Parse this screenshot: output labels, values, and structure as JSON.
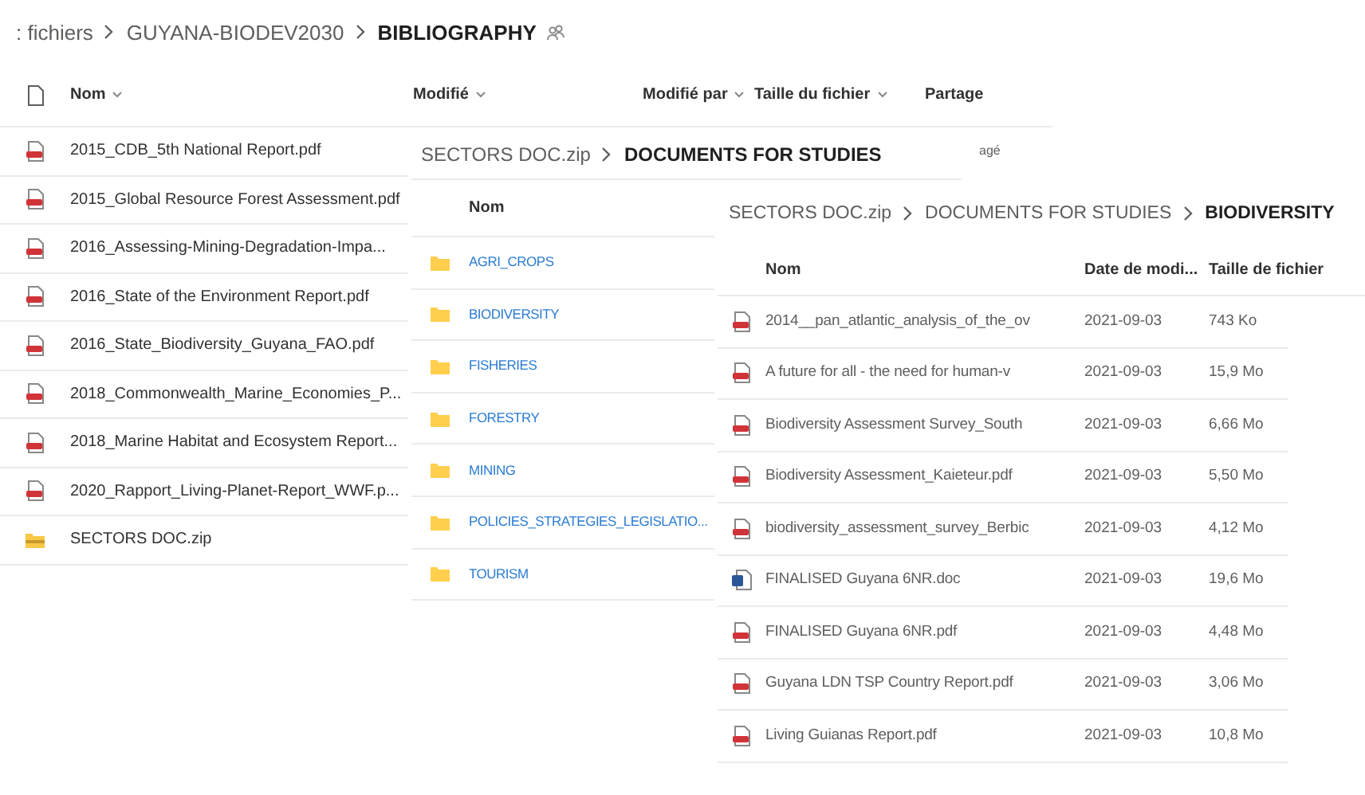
{
  "panels": [
    {
      "breadcrumb": [
        {
          "label": ": fichiers"
        },
        {
          "label": "GUYANA-BIODEV2030"
        },
        {
          "label": "BIBLIOGRAPHY"
        }
      ],
      "shared": true,
      "file_type_header": true,
      "columns": [
        {
          "label": "Nom",
          "sortable": true
        },
        {
          "label": "Modifié",
          "sortable": true
        },
        {
          "label": "Modifié par",
          "sortable": true
        },
        {
          "label": "Taille du fichier",
          "sortable": true
        },
        {
          "label": "Partage",
          "sortable": false
        }
      ],
      "rows": [
        {
          "kind": "pdf",
          "name": "2015_CDB_5th National Report.pdf",
          "sharing": "agé"
        },
        {
          "kind": "pdf",
          "name": "2015_Global Resource Forest Assessment.pdf"
        },
        {
          "kind": "pdf",
          "name": "2016_Assessing-Mining-Degradation-Impa..."
        },
        {
          "kind": "pdf",
          "name": "2016_State of the Environment Report.pdf"
        },
        {
          "kind": "pdf",
          "name": "2016_State_Biodiversity_Guyana_FAO.pdf"
        },
        {
          "kind": "pdf",
          "name": "2018_Commonwealth_Marine_Economies_P..."
        },
        {
          "kind": "pdf",
          "name": "2018_Marine Habitat and Ecosystem Report..."
        },
        {
          "kind": "pdf",
          "name": "2020_Rapport_Living-Planet-Report_WWF.p..."
        },
        {
          "kind": "zip",
          "name": "SECTORS DOC.zip"
        }
      ]
    },
    {
      "breadcrumb": [
        {
          "label": "SECTORS DOC.zip"
        },
        {
          "label": "DOCUMENTS FOR STUDIES"
        }
      ],
      "columns": [
        {
          "label": "Nom",
          "sortable": false
        }
      ],
      "rows": [
        {
          "kind": "folder",
          "name": "AGRI_CROPS"
        },
        {
          "kind": "folder",
          "name": "BIODIVERSITY"
        },
        {
          "kind": "folder",
          "name": "FISHERIES"
        },
        {
          "kind": "folder",
          "name": "FORESTRY"
        },
        {
          "kind": "folder",
          "name": "MINING"
        },
        {
          "kind": "folder",
          "name": "POLICIES_STRATEGIES_LEGISLATIO..."
        },
        {
          "kind": "folder",
          "name": "TOURISM"
        }
      ]
    },
    {
      "breadcrumb": [
        {
          "label": "SECTORS DOC.zip"
        },
        {
          "label": "DOCUMENTS FOR STUDIES"
        },
        {
          "label": "BIODIVERSITY"
        }
      ],
      "columns": [
        {
          "label": "Nom",
          "sortable": false
        },
        {
          "label": "Date de modi...",
          "sortable": false
        },
        {
          "label": "Taille de fichier",
          "sortable": false
        }
      ],
      "rows": [
        {
          "kind": "pdf",
          "name": "2014__pan_atlantic_analysis_of_the_ov",
          "date": "2021-09-03",
          "size": "743 Ko"
        },
        {
          "kind": "pdf",
          "name": "A future for all - the need for human-v",
          "date": "2021-09-03",
          "size": "15,9 Mo"
        },
        {
          "kind": "pdf",
          "name": "Biodiversity Assessment Survey_South",
          "date": "2021-09-03",
          "size": "6,66 Mo"
        },
        {
          "kind": "pdf",
          "name": "Biodiversity Assessment_Kaieteur.pdf",
          "date": "2021-09-03",
          "size": "5,50 Mo"
        },
        {
          "kind": "pdf",
          "name": "biodiversity_assessment_survey_Berbic",
          "date": "2021-09-03",
          "size": "4,12 Mo"
        },
        {
          "kind": "doc",
          "name": "FINALISED Guyana 6NR.doc",
          "date": "2021-09-03",
          "size": "19,6 Mo"
        },
        {
          "kind": "pdf",
          "name": "FINALISED Guyana 6NR.pdf",
          "date": "2021-09-03",
          "size": "4,48 Mo"
        },
        {
          "kind": "pdf",
          "name": "Guyana LDN TSP Country Report.pdf",
          "date": "2021-09-03",
          "size": "3,06 Mo"
        },
        {
          "kind": "pdf",
          "name": "Living Guianas Report.pdf",
          "date": "2021-09-03",
          "size": "10,8 Mo"
        }
      ]
    }
  ]
}
